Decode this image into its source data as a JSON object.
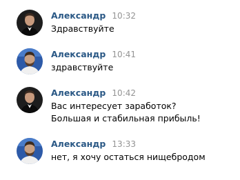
{
  "messages": [
    {
      "author": "Александр",
      "time": "10:32",
      "text": "Здравствуйте",
      "avatar": "avatar-man-in-tuxedo"
    },
    {
      "author": "Александр",
      "time": "10:41",
      "text": "здравствуйте",
      "avatar": "avatar-bearded-man"
    },
    {
      "author": "Александр",
      "time": "10:42",
      "text": "Вас интересует заработок?\nБольшая и стабильная прибыль!",
      "avatar": "avatar-man-in-tuxedo"
    },
    {
      "author": "Александр",
      "time": "13:33",
      "text": "нет, я хочу остаться нищебродом",
      "avatar": "avatar-bearded-man"
    }
  ],
  "colors": {
    "author": "#2a5885",
    "time": "#939393",
    "text": "#000000",
    "background": "#ffffff"
  }
}
